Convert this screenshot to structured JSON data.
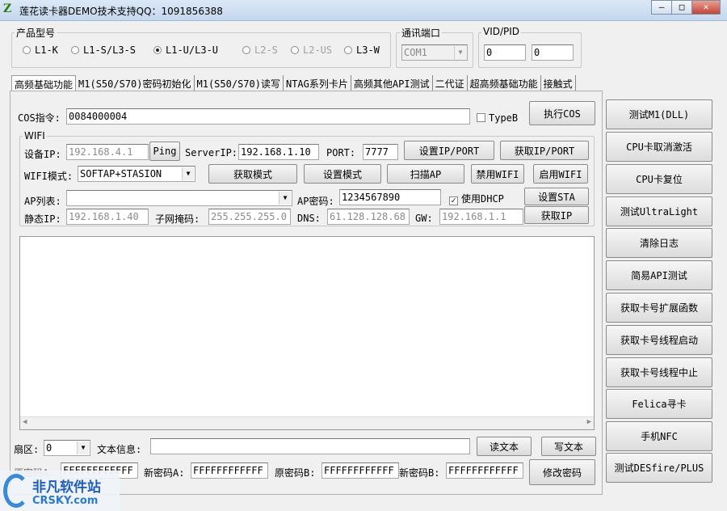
{
  "window": {
    "title": "莲花读卡器DEMO技术支持QQ：1091856388",
    "controls": [
      "–",
      "□",
      "✕"
    ]
  },
  "product": {
    "label": "产品型号",
    "options": [
      {
        "label": "L1-K",
        "checked": false,
        "enabled": true
      },
      {
        "label": "L1-S/L3-S",
        "checked": false,
        "enabled": true
      },
      {
        "label": "L1-U/L3-U",
        "checked": true,
        "enabled": true
      },
      {
        "label": "L2-S",
        "checked": false,
        "enabled": false
      },
      {
        "label": "L2-US",
        "checked": false,
        "enabled": false
      },
      {
        "label": "L3-W",
        "checked": false,
        "enabled": true
      }
    ]
  },
  "port": {
    "label": "通讯端口",
    "value": "COM1"
  },
  "vidpid": {
    "label": "VID/PID",
    "vid": "0",
    "pid": "0"
  },
  "tabs": [
    "高频基础功能",
    "M1(S50/S70)密码初始化",
    "M1(S50/S70)读写",
    "NTAG系列卡片",
    "高频其他API测试",
    "二代证",
    "超高频基础功能",
    "接触式"
  ],
  "cos": {
    "label": "COS指令:",
    "value": "0084000004",
    "typeb": "TypeB",
    "exec": "执行COS"
  },
  "wifi": {
    "label": "WIFI",
    "device_ip_label": "设备IP:",
    "device_ip": "192.168.4.1",
    "ping": "Ping",
    "server_ip_label": "ServerIP:",
    "server_ip": "192.168.1.10",
    "port_label": "PORT:",
    "port": "7777",
    "set_ip_port": "设置IP/PORT",
    "get_ip_port": "获取IP/PORT",
    "mode_label": "WIFI模式:",
    "mode": "SOFTAP+STASION",
    "get_mode": "获取模式",
    "set_mode": "设置模式",
    "scan_ap": "扫描AP",
    "disable_wifi": "禁用WIFI",
    "enable_wifi": "启用WIFI",
    "ap_list_label": "AP列表:",
    "ap_list": "",
    "ap_pwd_label": "AP密码:",
    "ap_pwd": "1234567890",
    "dhcp": "使用DHCP",
    "set_sta": "设置STA",
    "static_ip_label": "静态IP:",
    "static_ip": "192.168.1.40",
    "mask_label": "子网掩码:",
    "mask": "255.255.255.0",
    "dns_label": "DNS:",
    "dns": "61.128.128.68",
    "gw_label": "GW:",
    "gw": "192.168.1.1",
    "get_ip": "获取IP"
  },
  "bottom": {
    "sector_label": "扇区:",
    "sector": "0",
    "text_label": "文本信息:",
    "text": "",
    "read_text": "读文本",
    "write_text": "写文本",
    "old_a_label": "原密码A:",
    "old_a": "FFFFFFFFFFFF",
    "new_a_label": "新密码A:",
    "new_a": "FFFFFFFFFFFF",
    "old_b_label": "原密码B:",
    "old_b": "FFFFFFFFFFFF",
    "new_b_label": "新密码B:",
    "new_b": "FFFFFFFFFFFF",
    "change_pwd": "修改密码"
  },
  "right_buttons": [
    "测试M1(DLL)",
    "CPU卡取消激活",
    "CPU卡复位",
    "测试UltraLight",
    "清除日志",
    "简易API测试",
    "获取卡号扩展函数",
    "获取卡号线程启动",
    "获取卡号线程中止",
    "Felica寻卡",
    "手机NFC",
    "测试DESfire/PLUS"
  ],
  "watermark": {
    "line1": "非凡软件站",
    "line2": "CRSKY.com"
  }
}
